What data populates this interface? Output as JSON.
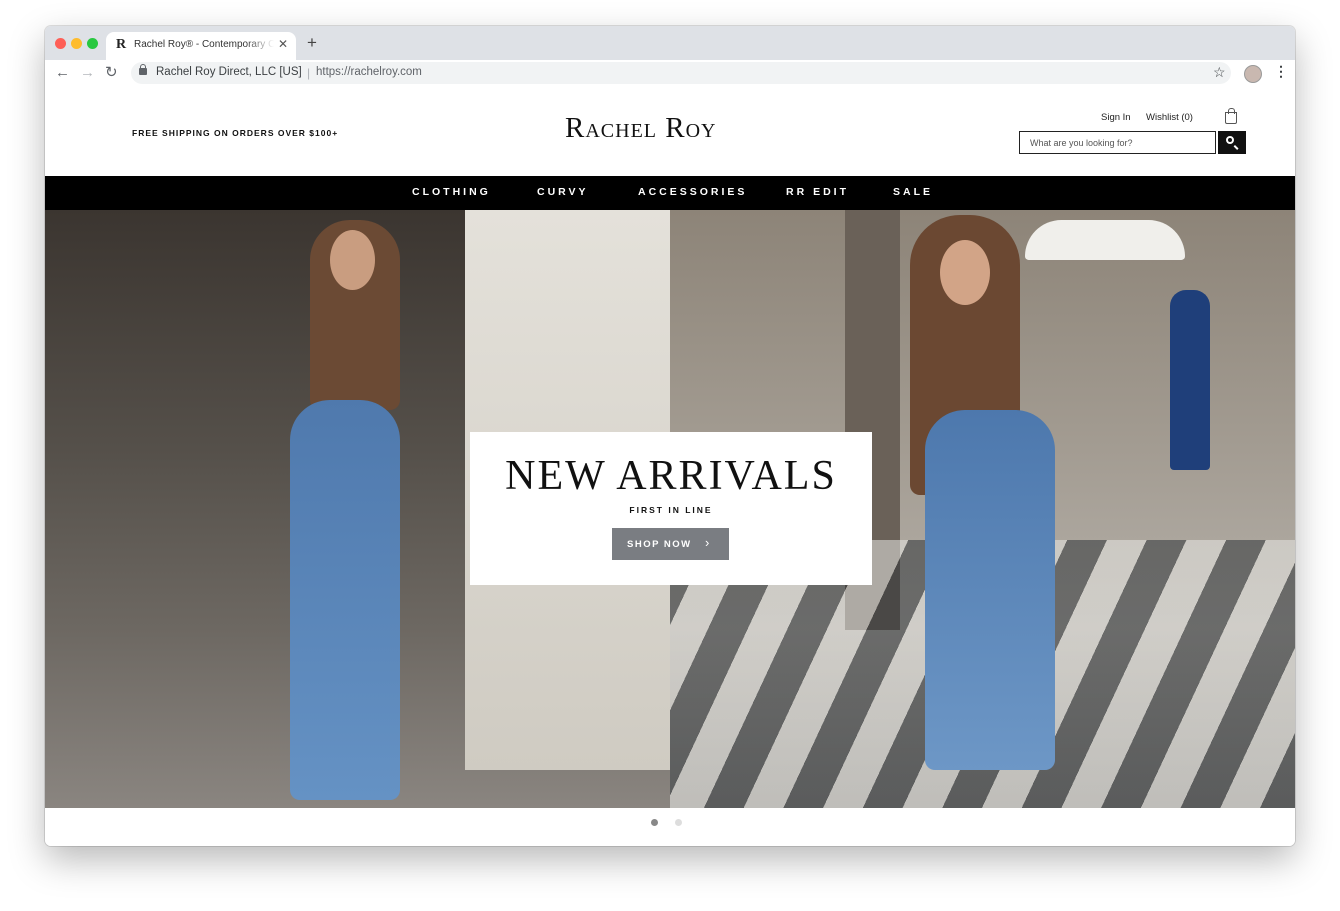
{
  "browser": {
    "tab_title": "Rachel Roy® - Contemporary Clothing",
    "tab_favicon": "R",
    "tab_close": "✕",
    "new_tab": "+",
    "back": "←",
    "forward": "→",
    "reload": "↻",
    "site_identity": "Rachel Roy Direct, LLC [US]",
    "url_separator": "|",
    "url": "https://rachelroy.com",
    "star": "☆",
    "menu": "⋮"
  },
  "header": {
    "promo": "FREE SHIPPING ON ORDERS OVER $100+",
    "logo": "Rachel Roy",
    "sign_in": "Sign In",
    "wishlist": "Wishlist (0)",
    "search_placeholder": "What are you looking for?"
  },
  "nav": {
    "items": [
      "CLOTHING",
      "CURVY",
      "ACCESSORIES",
      "RR EDIT",
      "SALE"
    ]
  },
  "hero": {
    "title": "NEW ARRIVALS",
    "subtitle": "FIRST IN LINE",
    "button_label": "SHOP NOW",
    "button_chevron": "›",
    "slide_count": 2,
    "active_slide": 1
  }
}
